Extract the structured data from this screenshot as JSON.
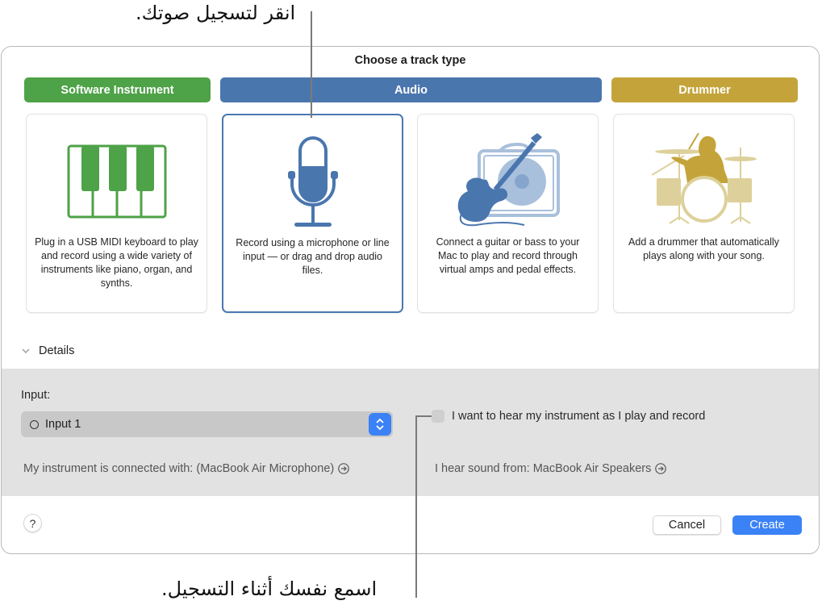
{
  "callouts": {
    "top": "انقر لتسجيل صوتك.",
    "bottom": "اسمع نفسك أثناء التسجيل."
  },
  "dialog": {
    "title": "Choose a track type",
    "track_types": [
      {
        "label": "Software Instrument",
        "color": "#4ea247",
        "selected": false,
        "description": "Plug in a USB MIDI keyboard to play and record using a wide variety of instruments like piano, organ, and synths.",
        "icon": "piano-keys-icon"
      },
      {
        "label": "Audio",
        "color": "#4a76ae",
        "selected": true,
        "description": "Record using a microphone or line input — or drag and drop audio files.",
        "icon": "microphone-icon"
      },
      {
        "label": "Drummer",
        "color": "#c4a43a",
        "selected": false,
        "description": "Add a drummer that automatically plays along with your song.",
        "icon": "drummer-icon"
      }
    ],
    "guitar_card": {
      "description": "Connect a guitar or bass to your Mac to play and record through virtual amps and pedal effects.",
      "icon": "guitar-amp-icon"
    },
    "details": {
      "toggle_label": "Details",
      "input_label": "Input:",
      "input_value": "Input 1",
      "monitor_checkbox_label": "I want to hear my instrument as I play and record",
      "monitor_checked": false,
      "instrument_connection": "My instrument is connected with: (MacBook Air Microphone)",
      "output_device": "I hear sound from: MacBook Air Speakers"
    },
    "footer": {
      "help_label": "?",
      "cancel_label": "Cancel",
      "create_label": "Create"
    }
  }
}
